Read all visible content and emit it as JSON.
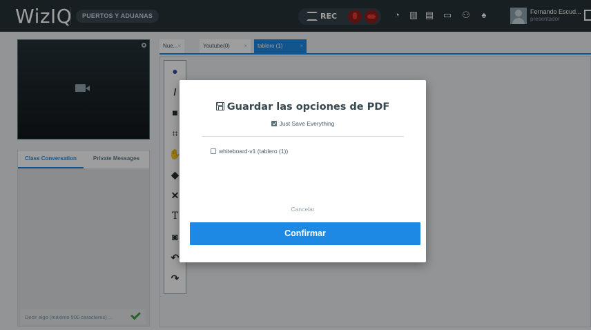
{
  "header": {
    "logo": "WizIQ",
    "class_name": "PUERTOS Y ADUANAS",
    "rec_label": "REC",
    "user_name": "Fernando Escud...",
    "user_role": "presentador",
    "icons": [
      "clock-icon",
      "chart-icon",
      "layout-icon",
      "screen-share-icon",
      "participants-icon",
      "notification-icon"
    ]
  },
  "chat": {
    "tabs": [
      {
        "label": "Class Conversation",
        "active": true
      },
      {
        "label": "Private Messages",
        "active": false
      }
    ],
    "input_placeholder": "Decir algo (máximo 500 caracteres) ..."
  },
  "workspace": {
    "tabs": [
      {
        "label": "Nue...",
        "close": "×",
        "active": false
      },
      {
        "label": "Youtube(0)",
        "close": "×",
        "active": false
      },
      {
        "label": "tablero (1)",
        "close": "×",
        "active": true
      }
    ],
    "tools": [
      "palette-icon",
      "pen-icon",
      "shapes-icon",
      "crop-icon",
      "hand-icon",
      "eraser-icon",
      "close-icon",
      "text-icon",
      "camera-icon",
      "undo-icon",
      "redo-icon"
    ]
  },
  "modal": {
    "title": "Guardar las opciones de PDF",
    "save_everything_label": "Just Save Everything",
    "save_everything_checked": true,
    "files": [
      {
        "label": "whiteboard-v1 (tablero (1))",
        "checked": false
      }
    ],
    "cancel_label": "Cancelar",
    "confirm_label": "Confirmar"
  },
  "colors": {
    "accent": "#1e88e5",
    "topbar": "#263238",
    "rec": "#e53935",
    "send": "#43a047"
  }
}
